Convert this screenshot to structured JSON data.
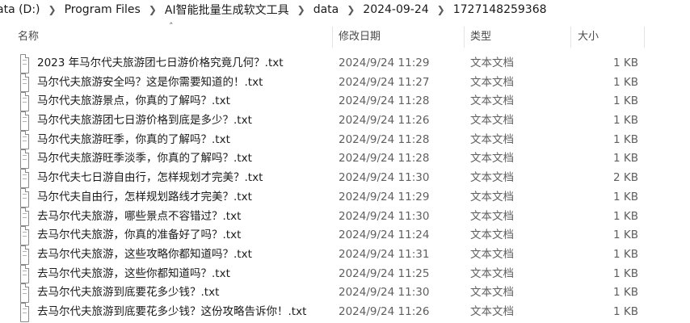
{
  "breadcrumb": [
    "ata (D:)",
    "Program Files",
    "AI智能批量生成软文工具",
    "data",
    "2024-09-24",
    "1727148259368"
  ],
  "columns": {
    "name": "名称",
    "date": "修改日期",
    "type": "类型",
    "size": "大小"
  },
  "files": [
    {
      "name": "2023 年马尔代夫旅游团七日游价格究竟几何？.txt",
      "date": "2024/9/24 11:29",
      "type": "文本文档",
      "size": "1 KB"
    },
    {
      "name": "马尔代夫旅游安全吗？这是你需要知道的！.txt",
      "date": "2024/9/24 11:27",
      "type": "文本文档",
      "size": "1 KB"
    },
    {
      "name": "马尔代夫旅游景点，你真的了解吗？.txt",
      "date": "2024/9/24 11:28",
      "type": "文本文档",
      "size": "1 KB"
    },
    {
      "name": "马尔代夫旅游团七日游价格到底是多少？.txt",
      "date": "2024/9/24 11:26",
      "type": "文本文档",
      "size": "1 KB"
    },
    {
      "name": "马尔代夫旅游旺季，你真的了解吗？.txt",
      "date": "2024/9/24 11:28",
      "type": "文本文档",
      "size": "1 KB"
    },
    {
      "name": "马尔代夫旅游旺季淡季，你真的了解吗？.txt",
      "date": "2024/9/24 11:28",
      "type": "文本文档",
      "size": "1 KB"
    },
    {
      "name": "马尔代夫七日游自由行，怎样规划才完美？.txt",
      "date": "2024/9/24 11:30",
      "type": "文本文档",
      "size": "2 KB"
    },
    {
      "name": "马尔代夫自由行，怎样规划路线才完美？.txt",
      "date": "2024/9/24 11:29",
      "type": "文本文档",
      "size": "1 KB"
    },
    {
      "name": "去马尔代夫旅游，哪些景点不容错过？.txt",
      "date": "2024/9/24 11:30",
      "type": "文本文档",
      "size": "1 KB"
    },
    {
      "name": "去马尔代夫旅游，你真的准备好了吗？.txt",
      "date": "2024/9/24 11:24",
      "type": "文本文档",
      "size": "1 KB"
    },
    {
      "name": "去马尔代夫旅游，这些攻略你都知道吗？.txt",
      "date": "2024/9/24 11:31",
      "type": "文本文档",
      "size": "1 KB"
    },
    {
      "name": "去马尔代夫旅游，这些你都知道吗？.txt",
      "date": "2024/9/24 11:25",
      "type": "文本文档",
      "size": "1 KB"
    },
    {
      "name": "去马尔代夫旅游到底要花多少钱？.txt",
      "date": "2024/9/24 11:30",
      "type": "文本文档",
      "size": "1 KB"
    },
    {
      "name": "去马尔代夫旅游到底要花多少钱？这份攻略告诉你！.txt",
      "date": "2024/9/24 11:26",
      "type": "文本文档",
      "size": "1 KB"
    }
  ]
}
